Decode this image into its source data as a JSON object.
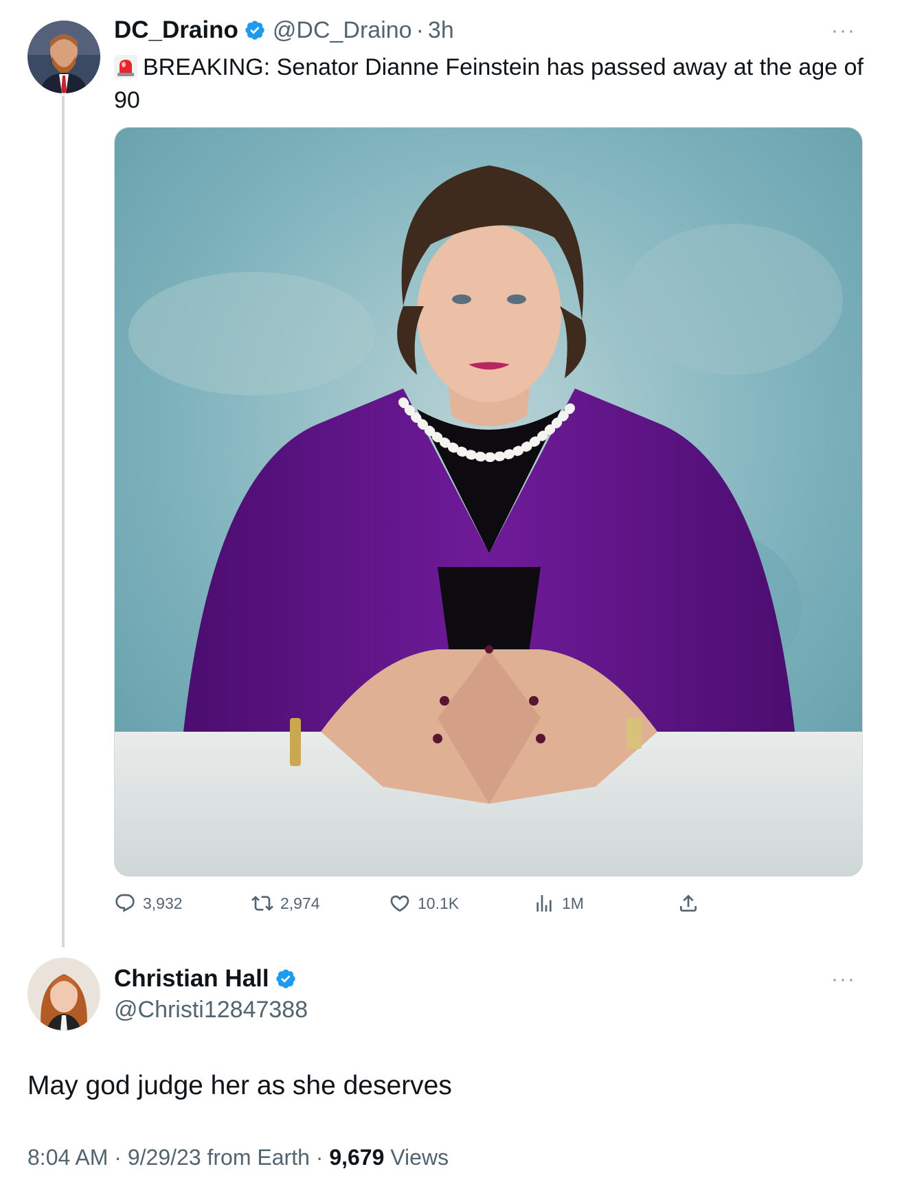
{
  "tweet": {
    "author_name": "DC_Draino",
    "handle": "@DC_Draino",
    "separator": "·",
    "time": "3h",
    "more": "···",
    "text": "BREAKING: Senator Dianne Feinstein has passed away at the age of 90",
    "emoji": "siren-icon",
    "image_description_icon": "portrait-photo",
    "stats": {
      "replies": "3,932",
      "reposts": "2,974",
      "likes": "10.1K",
      "views": "1M"
    }
  },
  "reply": {
    "author_name": "Christian Hall",
    "handle": "@Christi12847388",
    "more": "···",
    "text": "May god judge her as she deserves",
    "meta": {
      "time": "8:04 AM",
      "separator": "·",
      "date": "9/29/23 from Earth",
      "views_count": "9,679",
      "views_label": "Views"
    }
  },
  "colors": {
    "verified": "#1d9bf0",
    "secondary_text": "#536471",
    "thread_line": "#cfd9de"
  }
}
